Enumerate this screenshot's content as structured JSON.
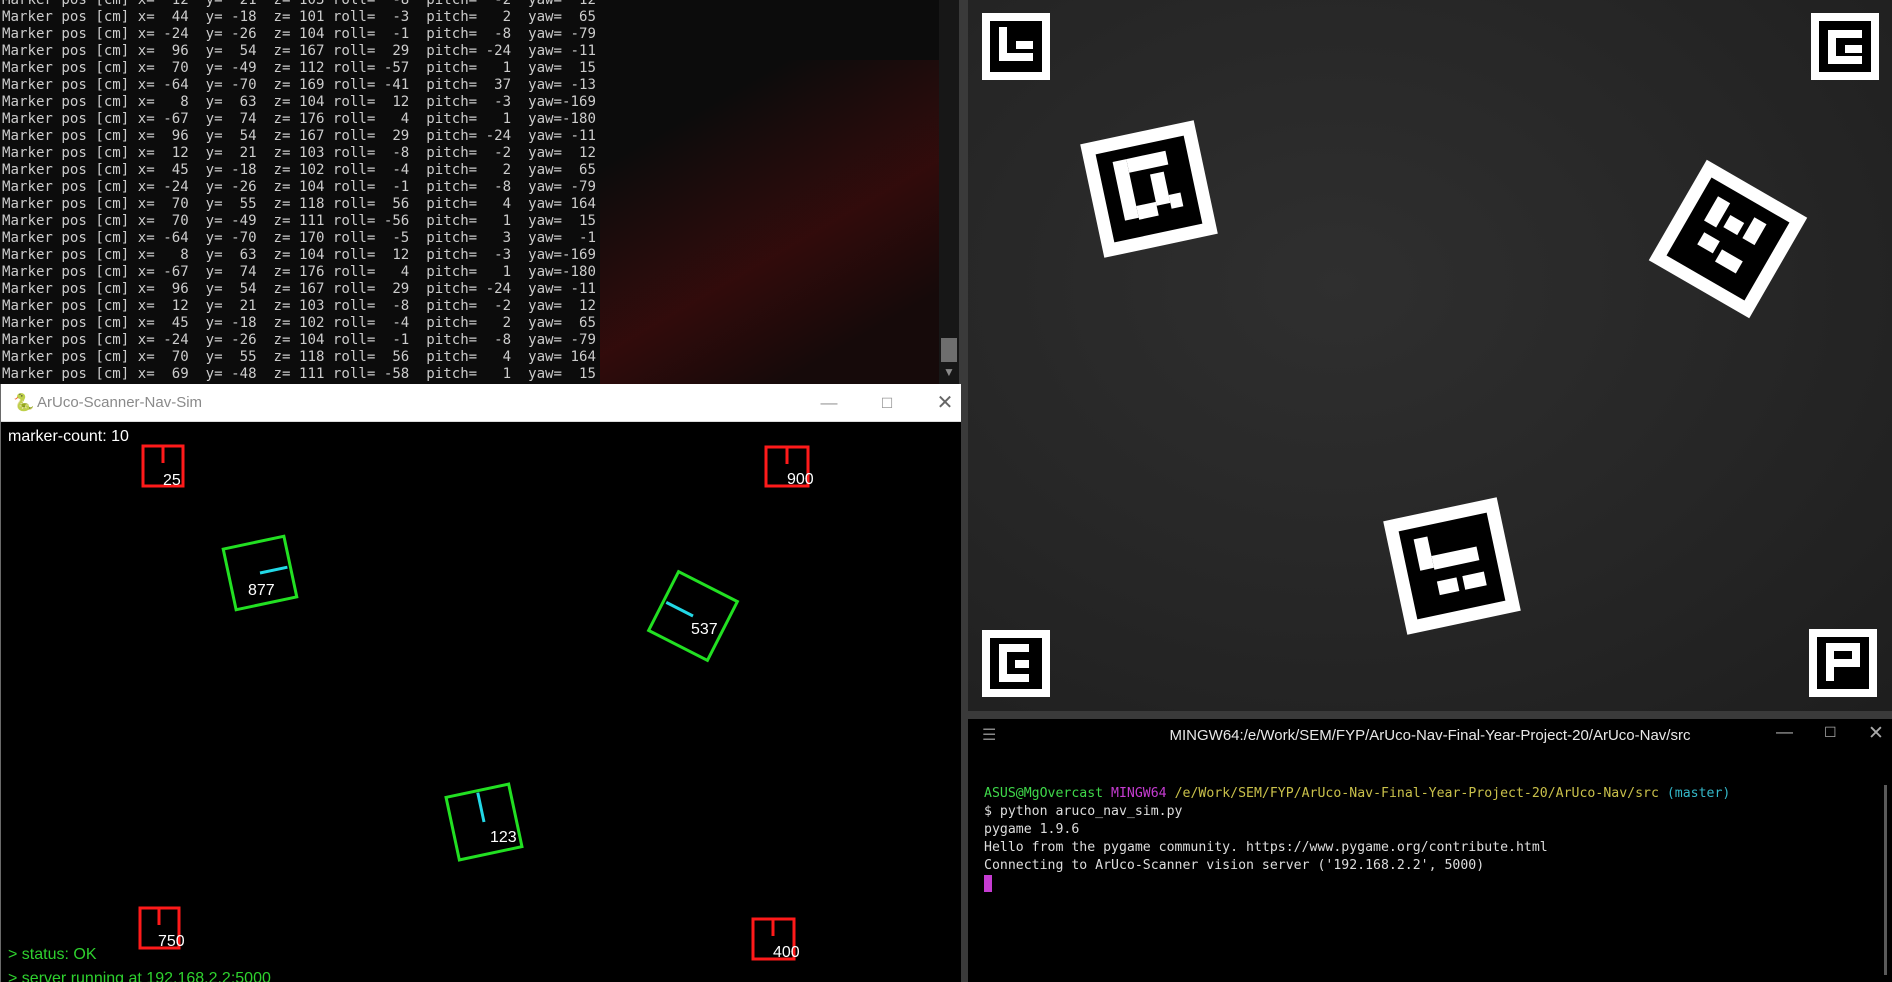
{
  "console": {
    "lines": [
      "Marker pos [cm] x=  12  y=  21  z= 103 roll=  -8  pitch=  -2  yaw=  12",
      "Marker pos [cm] x=  44  y= -18  z= 101 roll=  -3  pitch=   2  yaw=  65",
      "Marker pos [cm] x= -24  y= -26  z= 104 roll=  -1  pitch=  -8  yaw= -79",
      "Marker pos [cm] x=  96  y=  54  z= 167 roll=  29  pitch= -24  yaw= -11",
      "Marker pos [cm] x=  70  y= -49  z= 112 roll= -57  pitch=   1  yaw=  15",
      "Marker pos [cm] x= -64  y= -70  z= 169 roll= -41  pitch=  37  yaw= -13",
      "Marker pos [cm] x=   8  y=  63  z= 104 roll=  12  pitch=  -3  yaw=-169",
      "Marker pos [cm] x= -67  y=  74  z= 176 roll=   4  pitch=   1  yaw=-180",
      "Marker pos [cm] x=  96  y=  54  z= 167 roll=  29  pitch= -24  yaw= -11",
      "Marker pos [cm] x=  12  y=  21  z= 103 roll=  -8  pitch=  -2  yaw=  12",
      "Marker pos [cm] x=  45  y= -18  z= 102 roll=  -4  pitch=   2  yaw=  65",
      "Marker pos [cm] x= -24  y= -26  z= 104 roll=  -1  pitch=  -8  yaw= -79",
      "Marker pos [cm] x=  70  y=  55  z= 118 roll=  56  pitch=   4  yaw= 164",
      "Marker pos [cm] x=  70  y= -49  z= 111 roll= -56  pitch=   1  yaw=  15",
      "Marker pos [cm] x= -64  y= -70  z= 170 roll=  -5  pitch=   3  yaw=  -1",
      "Marker pos [cm] x=   8  y=  63  z= 104 roll=  12  pitch=  -3  yaw=-169",
      "Marker pos [cm] x= -67  y=  74  z= 176 roll=   4  pitch=   1  yaw=-180",
      "Marker pos [cm] x=  96  y=  54  z= 167 roll=  29  pitch= -24  yaw= -11",
      "Marker pos [cm] x=  12  y=  21  z= 103 roll=  -8  pitch=  -2  yaw=  12",
      "Marker pos [cm] x=  45  y= -18  z= 102 roll=  -4  pitch=   2  yaw=  65",
      "Marker pos [cm] x= -24  y= -26  z= 104 roll=  -1  pitch=  -8  yaw= -79",
      "Marker pos [cm] x=  70  y=  55  z= 118 roll=  56  pitch=   4  yaw= 164",
      "Marker pos [cm] x=  69  y= -48  z= 111 roll= -58  pitch=   1  yaw=  15"
    ]
  },
  "sim_window": {
    "title": "ArUco-Scanner-Nav-Sim",
    "marker_count_label": "marker-count: 10",
    "status_label": "> status: OK",
    "server_label": "> server running at 192.168.2.2:5000",
    "anchor_markers": [
      {
        "id": "25"
      },
      {
        "id": "900"
      },
      {
        "id": "750"
      },
      {
        "id": "400"
      }
    ],
    "moving_markers": [
      {
        "id": "877"
      },
      {
        "id": "537"
      },
      {
        "id": "123"
      }
    ],
    "colors": {
      "anchor": "#ff1a1a",
      "moving": "#22e022",
      "heading": "#22d8e6",
      "status_text": "#2ed12e",
      "label": "#ffffff"
    }
  },
  "terminal": {
    "title": "MINGW64:/e/Work/SEM/FYP/ArUco-Nav-Final-Year-Project-20/ArUco-Nav/src",
    "prompt_user": "ASUS@MgOvercast",
    "prompt_env": "MINGW64",
    "prompt_path": "/e/Work/SEM/FYP/ArUco-Nav-Final-Year-Project-20/ArUco-Nav/src",
    "prompt_branch": "(master)",
    "command": "$ python aruco_nav_sim.py",
    "output": [
      "pygame 1.9.6",
      "Hello from the pygame community. https://www.pygame.org/contribute.html",
      "Connecting to ArUco-Scanner vision server ('192.168.2.2', 5000)"
    ]
  },
  "icons": {
    "sim_app": "pygame-snake-icon",
    "minimize": "minimize-icon",
    "maximize": "maximize-icon",
    "close": "close-icon",
    "menu": "hamburger-menu-icon"
  }
}
